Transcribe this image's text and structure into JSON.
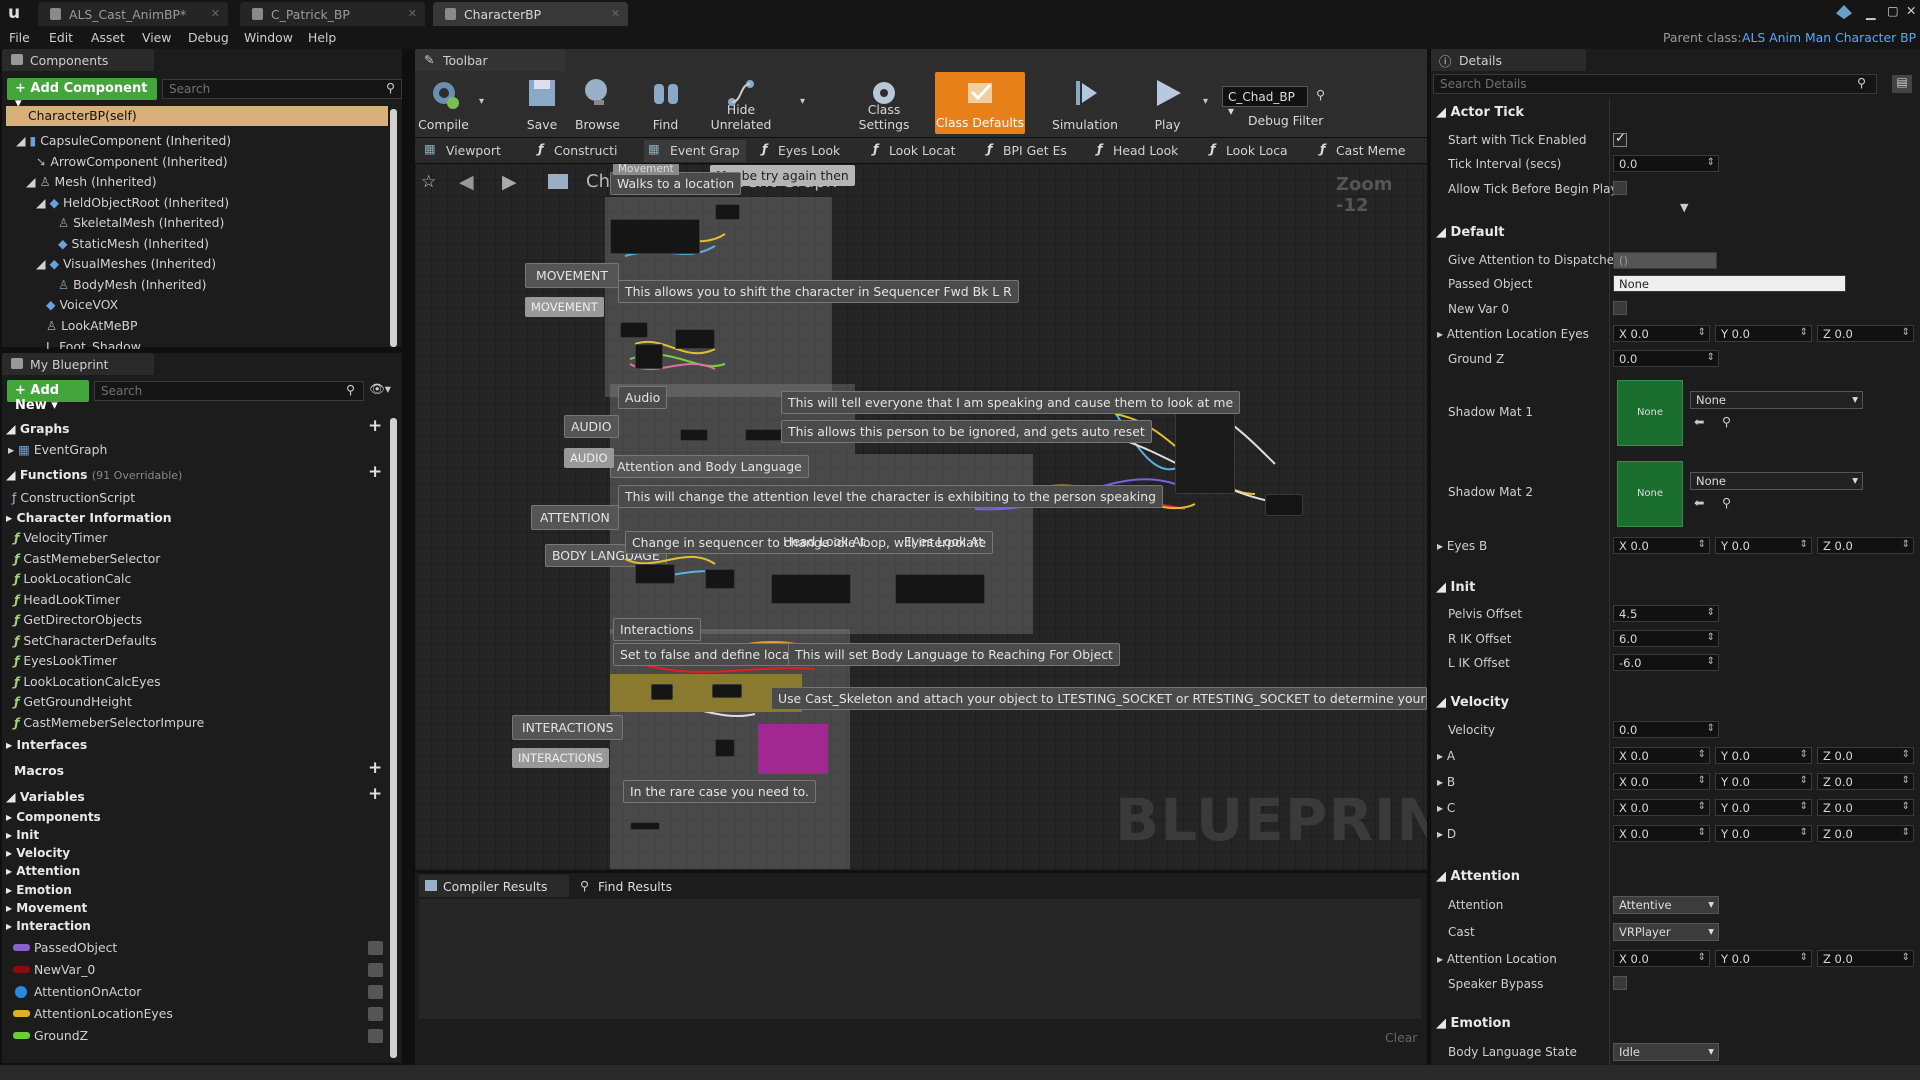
{
  "tabs": [
    {
      "label": "ALS_Cast_AnimBP*"
    },
    {
      "label": "C_Patrick_BP"
    },
    {
      "label": "CharacterBP"
    }
  ],
  "menu": [
    "File",
    "Edit",
    "Asset",
    "View",
    "Debug",
    "Window",
    "Help"
  ],
  "parent_class": {
    "label": "Parent class:",
    "value": "ALS Anim Man Character BP"
  },
  "components": {
    "title": "Components",
    "add_label": "+ Add Component ▾",
    "search_placeholder": "Search",
    "self_item": "CharacterBP(self)",
    "items": [
      "CapsuleComponent (Inherited)",
      "ArrowComponent (Inherited)",
      "Mesh (Inherited)",
      "HeldObjectRoot (Inherited)",
      "SkeletalMesh (Inherited)",
      "StaticMesh (Inherited)",
      "VisualMeshes (Inherited)",
      "BodyMesh (Inherited)",
      "VoiceVOX",
      "LookAtMeBP",
      "L_Foot_Shadow"
    ]
  },
  "my_blueprint": {
    "title": "My Blueprint",
    "add_label": "+ Add New ▾",
    "search_placeholder": "Search",
    "graphs_label": "Graphs",
    "event_graph": "EventGraph",
    "functions_label": "Functions",
    "functions_count": "(91 Overridable)",
    "construction": "ConstructionScript",
    "char_info": "Character Information",
    "functions": [
      "VelocityTimer",
      "CastMemeberSelector",
      "LookLocationCalc",
      "HeadLookTimer",
      "GetDirectorObjects",
      "SetCharacterDefaults",
      "EyesLookTimer",
      "LookLocationCalcEyes",
      "GetGroundHeight",
      "CastMemeberSelectorImpure"
    ],
    "interfaces_label": "Interfaces",
    "macros_label": "Macros",
    "variables_label": "Variables",
    "var_categories": [
      "Components",
      "Init",
      "Velocity",
      "Attention",
      "Emotion",
      "Movement",
      "Interaction"
    ],
    "variables": [
      {
        "name": "PassedObject",
        "color": "#8c5fd0"
      },
      {
        "name": "NewVar_0",
        "color": "#8a0d0d"
      },
      {
        "name": "AttentionOnActor",
        "color": "#2a8ae0"
      },
      {
        "name": "AttentionLocationEyes",
        "color": "#e0b020"
      },
      {
        "name": "GroundZ",
        "color": "#6ad030"
      }
    ]
  },
  "toolbar": {
    "title": "Toolbar",
    "buttons": [
      "Compile",
      "Save",
      "Browse",
      "Find",
      "Hide Unrelated",
      "Class Settings",
      "Class Defaults",
      "Simulation",
      "Play"
    ],
    "debug_object": "C_Chad_BP ▾",
    "debug_filter": "Debug Filter"
  },
  "graph_tabs": [
    "Viewport",
    "Constructi",
    "Event Grap",
    "Eyes Look",
    "Look Locat",
    "BPI Get Es",
    "Head Look",
    "Look Loca",
    "Cast Meme"
  ],
  "graph": {
    "breadcrumb_root": "CharacterBP",
    "breadcrumb_sep": ">",
    "breadcrumb_leaf": "Event Graph",
    "zoom": "Zoom -12",
    "watermark": "BLUEPRINT",
    "small_header": "Movement",
    "comments": {
      "walks": "Walks to a location",
      "maybe": "Maybe try again then",
      "shift": "This allows you to shift the character in Sequencer Fwd Bk L R",
      "audio": "Audio",
      "tell": "This will tell everyone that I am speaking and cause them to look at me",
      "ignored": "This allows this person to be ignored, and gets auto reset",
      "attn_body": "Attention and Body Language",
      "change_attn": "This will change the attention level the character is exhibiting to the person speaking",
      "change_seq": "Change in sequencer to change idle loop, will interpolate",
      "head_look": "Head Look At",
      "eyes_look": "Eyes Look At",
      "interactions": "Interactions",
      "set_false": "Set to false and define location",
      "body_lang_set": "This will set Body Language to Reaching For Object",
      "cast_skel": "Use Cast_Skeleton and attach your object to LTESTING_SOCKET or RTESTING_SOCKET to determine your Transform",
      "in_case": "In the rare case you need to."
    },
    "labels": {
      "movement": "MOVEMENT",
      "audio": "AUDIO",
      "attention": "ATTENTION",
      "body_language": "BODY LANGUAGE",
      "interactions": "INTERACTIONS"
    }
  },
  "bottom": {
    "compiler_tab": "Compiler Results",
    "find_tab": "Find Results",
    "clear": "Clear"
  },
  "details": {
    "title": "Details",
    "search_placeholder": "Search Details",
    "actor_tick": "Actor Tick",
    "start_tick": "Start with Tick Enabled",
    "tick_interval": "Tick Interval (secs)",
    "tick_interval_val": "0.0",
    "allow_tick": "Allow Tick Before Begin Play",
    "default": "Default",
    "give_attention": "Give Attention to Dispatcher",
    "give_attention_val": "()",
    "passed_object": "Passed Object",
    "passed_object_val": "None",
    "new_var": "New Var 0",
    "attn_loc_eyes": "Attention Location Eyes",
    "ground_z": "Ground Z",
    "ground_z_val": "0.0",
    "shadow1": "Shadow Mat 1",
    "shadow2": "Shadow Mat 2",
    "none": "None",
    "eyes_b": "Eyes B",
    "init": "Init",
    "pelvis": "Pelvis Offset",
    "pelvis_val": "4.5",
    "rik": "R IK Offset",
    "rik_val": "6.0",
    "lik": "L IK Offset",
    "lik_val": "-6.0",
    "velocity_sec": "Velocity",
    "velocity": "Velocity",
    "velocity_val": "0.0",
    "vec_rows": [
      "A",
      "B",
      "C",
      "D"
    ],
    "attention_sec": "Attention",
    "attention": "Attention",
    "attention_val": "Attentive",
    "cast": "Cast",
    "cast_val": "VRPlayer",
    "attn_location": "Attention Location",
    "speaker_bypass": "Speaker Bypass",
    "emotion_sec": "Emotion",
    "body_state": "Body Language State",
    "body_state_val": "Idle",
    "x": "X 0.0",
    "y": "Y 0.0",
    "z": "Z 0.0"
  }
}
